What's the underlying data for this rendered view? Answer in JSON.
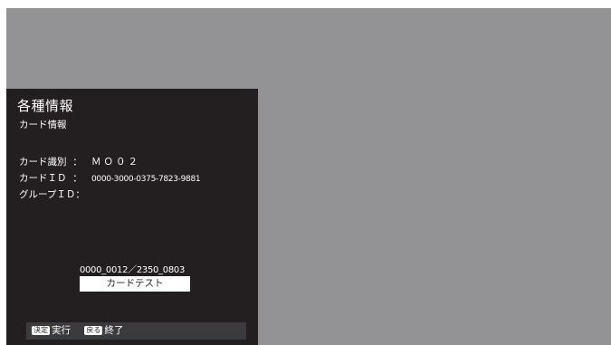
{
  "panel": {
    "title": "各種情報",
    "subtitle": "カード情報",
    "rows": [
      {
        "label": "カード識別",
        "sep": "：",
        "value": "ＭＯ０２"
      },
      {
        "label": "カードＩＤ",
        "sep": "：",
        "value": "0000-3000-0375-7823-9881"
      },
      {
        "label": "グループＩＤ",
        "sep": "：",
        "value": ""
      }
    ],
    "version": "0000_0012／2350_0803",
    "test_button": "カードテスト"
  },
  "footer": {
    "keys": [
      {
        "badge": "決定",
        "label": "実行"
      },
      {
        "badge": "戻る",
        "label": "終了"
      }
    ]
  },
  "colors": {
    "screen_bg": "#939395",
    "panel_bg": "#231f20",
    "footer_bg": "#3b3b3d"
  }
}
